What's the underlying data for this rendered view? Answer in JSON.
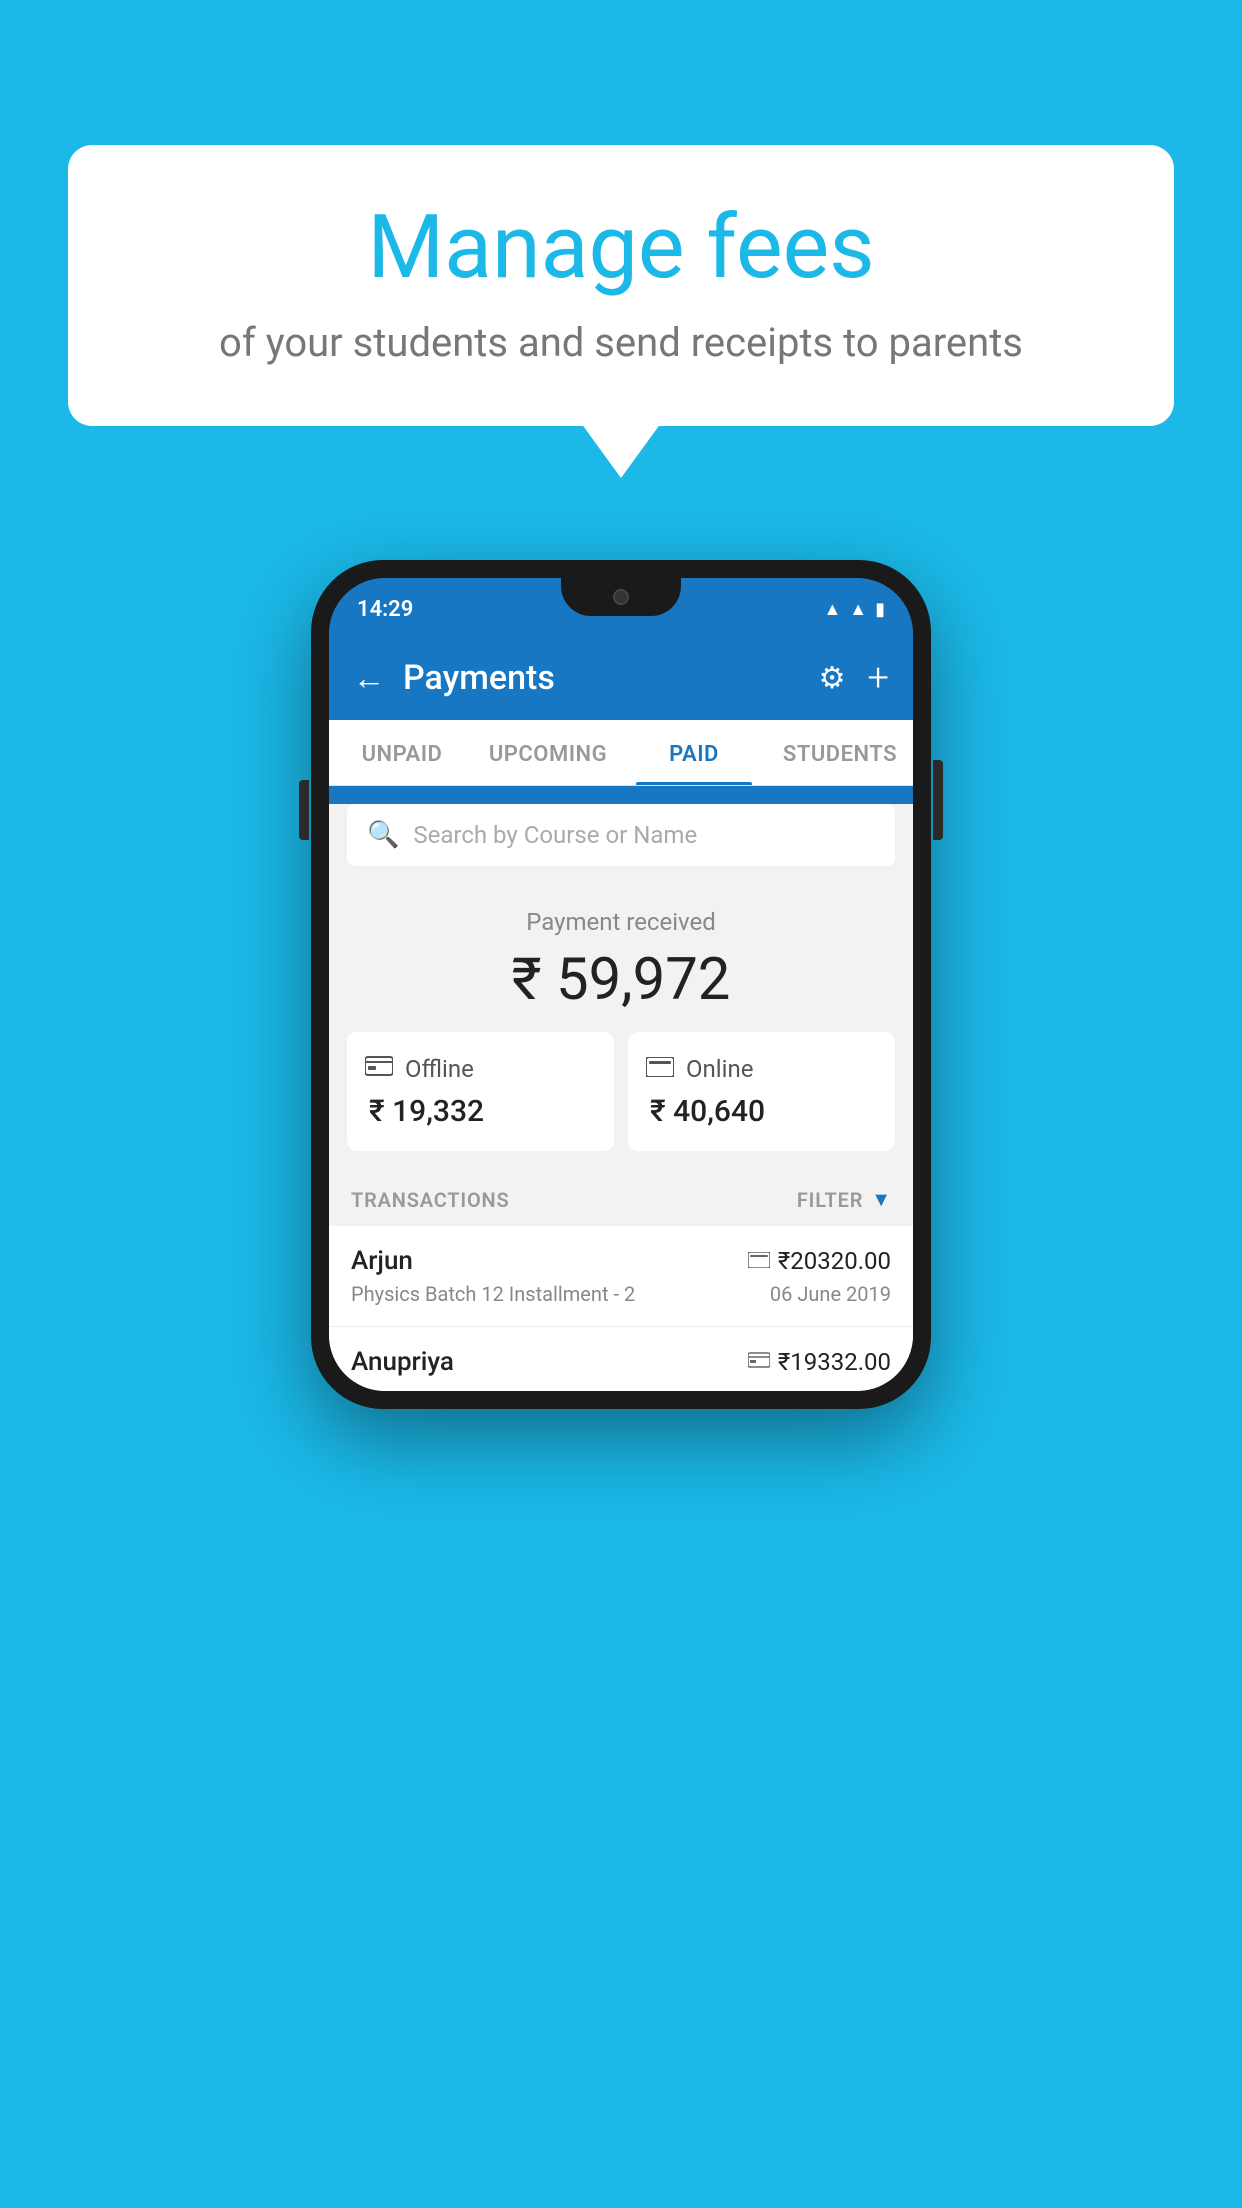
{
  "background_color": "#1bb8e8",
  "bubble": {
    "title": "Manage fees",
    "subtitle": "of your students and send receipts to parents"
  },
  "phone": {
    "status_bar": {
      "time": "14:29",
      "icons": [
        "wifi",
        "signal",
        "battery"
      ]
    },
    "header": {
      "title": "Payments",
      "back_label": "←",
      "settings_label": "⚙",
      "add_label": "+"
    },
    "tabs": [
      {
        "label": "UNPAID",
        "active": false
      },
      {
        "label": "UPCOMING",
        "active": false
      },
      {
        "label": "PAID",
        "active": true
      },
      {
        "label": "STUDENTS",
        "active": false
      }
    ],
    "search": {
      "placeholder": "Search by Course or Name"
    },
    "payment_summary": {
      "label": "Payment received",
      "amount": "₹ 59,972",
      "offline": {
        "type": "Offline",
        "amount": "₹ 19,332",
        "icon": "💳"
      },
      "online": {
        "type": "Online",
        "amount": "₹ 40,640",
        "icon": "💳"
      }
    },
    "transactions": {
      "section_label": "TRANSACTIONS",
      "filter_label": "FILTER",
      "rows": [
        {
          "name": "Arjun",
          "amount": "₹20320.00",
          "course": "Physics Batch 12 Installment - 2",
          "date": "06 June 2019",
          "payment_type": "online"
        },
        {
          "name": "Anupriya",
          "amount": "₹19332.00",
          "payment_type": "offline"
        }
      ]
    }
  }
}
